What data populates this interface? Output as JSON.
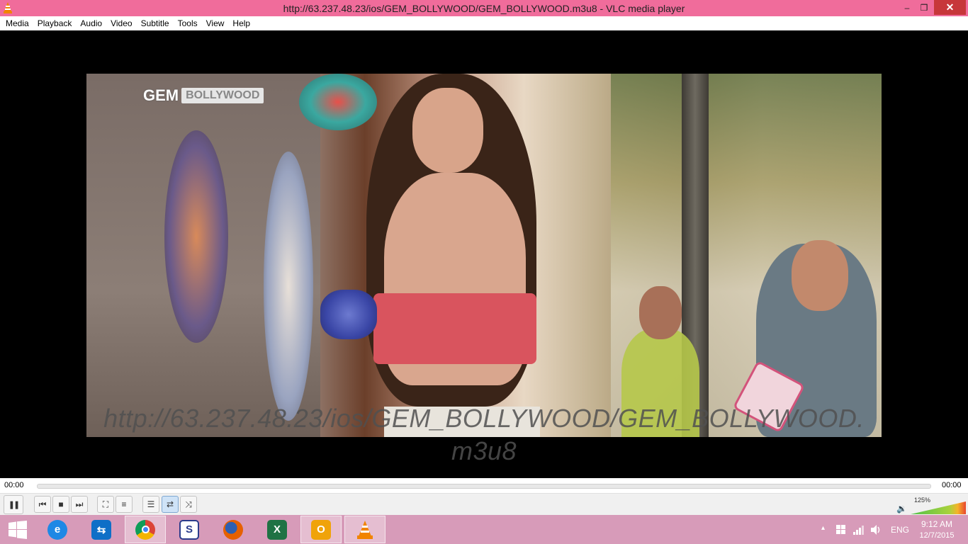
{
  "window": {
    "title": "http://63.237.48.23/ios/GEM_BOLLYWOOD/GEM_BOLLYWOOD.m3u8 - VLC media player",
    "minimize_glyph": "–",
    "maximize_glyph": "❒",
    "close_glyph": "✕"
  },
  "menu": {
    "items": [
      "Media",
      "Playback",
      "Audio",
      "Video",
      "Subtitle",
      "Tools",
      "View",
      "Help"
    ]
  },
  "video": {
    "channel_logo_gem": "GEM",
    "channel_logo_name": "BOLLYWOOD",
    "overlay_text": "http://63.237.48.23/ios/GEM_BOLLYWOOD/GEM_BOLLYWOOD.m3u8"
  },
  "seek": {
    "elapsed": "00:00",
    "total": "00:00",
    "progress": 0
  },
  "controls": {
    "pause": "❚❚",
    "prev": "⏮",
    "stop": "■",
    "next": "⏭",
    "fullscreen": "⛶",
    "extended": "≡",
    "playlist": "☰",
    "loop": "⇄",
    "random": "⤨",
    "loop_active": true,
    "volume_percent": "125%",
    "volume_level": 1.25,
    "speaker": "🔉"
  },
  "taskbar": {
    "apps": [
      {
        "name": "start",
        "glyph": "⊞",
        "color": "#d79bb9"
      },
      {
        "name": "internet-explorer",
        "glyph": "e",
        "color": "#1e88e5"
      },
      {
        "name": "teamviewer",
        "glyph": "⇆",
        "color": "#0e6fc7"
      },
      {
        "name": "chrome",
        "glyph": "●",
        "color": "#db4437"
      },
      {
        "name": "app-s",
        "glyph": "S",
        "color": "#2a3c8c"
      },
      {
        "name": "firefox",
        "glyph": "●",
        "color": "#e66000"
      },
      {
        "name": "excel",
        "glyph": "X",
        "color": "#1f7244"
      },
      {
        "name": "outlook",
        "glyph": "O",
        "color": "#f0a30a"
      },
      {
        "name": "vlc",
        "glyph": "▲",
        "color": "#f18400"
      }
    ],
    "tray": {
      "chevron": "▴",
      "language": "ENG",
      "time": "9:12 AM",
      "date": "12/7/2015"
    }
  }
}
